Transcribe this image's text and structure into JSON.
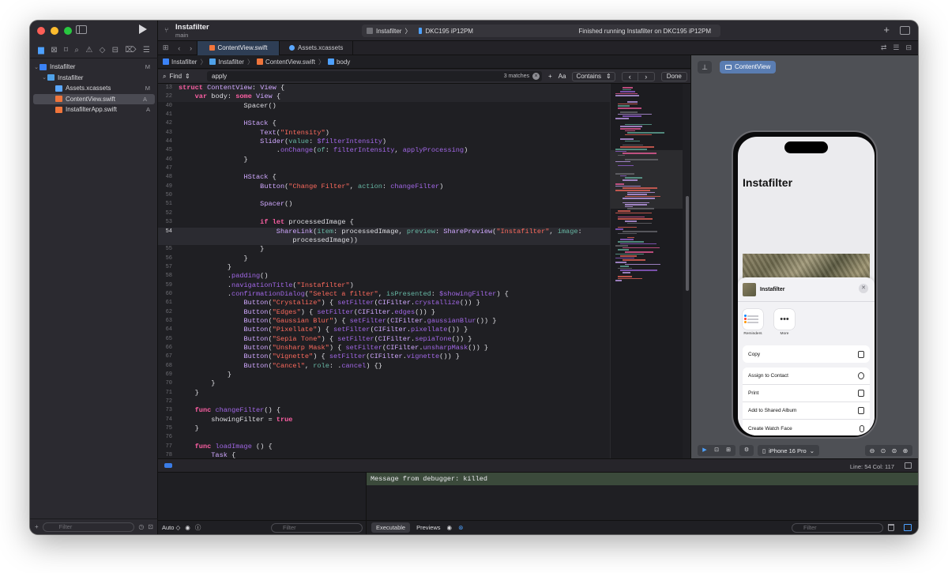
{
  "window": {
    "project_title": "Instafilter",
    "branch": "main",
    "scheme": "Instafilter",
    "device": "DKC195 iP12PM",
    "status": "Finished running Instafilter on DKC195 iP12PM"
  },
  "navigator": {
    "items": [
      {
        "label": "Instafilter",
        "badge": "M",
        "kind": "project",
        "depth": 0
      },
      {
        "label": "Instafilter",
        "badge": "",
        "kind": "folder",
        "depth": 1
      },
      {
        "label": "Assets.xcassets",
        "badge": "M",
        "kind": "assets",
        "depth": 2
      },
      {
        "label": "ContentView.swift",
        "badge": "A",
        "kind": "swift",
        "depth": 2,
        "selected": true
      },
      {
        "label": "InstafilterApp.swift",
        "badge": "A",
        "kind": "swift",
        "depth": 2
      }
    ],
    "filter_placeholder": "Filter"
  },
  "tabs": [
    {
      "label": "ContentView.swift",
      "active": true
    },
    {
      "label": "Assets.xcassets",
      "active": false
    }
  ],
  "jumpbar": {
    "items": [
      "Instafilter",
      "Instafilter",
      "ContentView.swift",
      "body"
    ]
  },
  "find": {
    "mode": "Find",
    "query": "apply",
    "matches": "3 matches",
    "case_label": "Aa",
    "contains_label": "Contains",
    "done_label": "Done"
  },
  "code": {
    "sticky": [
      {
        "n": "13",
        "html": "<span class='kw'>struct</span> <span class='ty'>ContentView</span>: <span class='ty'>View</span> {"
      },
      {
        "n": "22",
        "html": "    <span class='kw'>var</span> body: <span class='kw'>some</span> <span class='ty'>View</span> {"
      }
    ],
    "lines": [
      {
        "n": "40",
        "html": "                Spacer()"
      },
      {
        "n": "41",
        "html": ""
      },
      {
        "n": "42",
        "html": "                <span class='ty'>HStack</span> {"
      },
      {
        "n": "43",
        "html": "                    <span class='ty'>Text</span>(<span class='st'>\"Intensity\"</span>)"
      },
      {
        "n": "44",
        "html": "                    <span class='ty'>Slider</span>(<span class='pr'>value</span>: <span class='fn'>$filterIntensity</span>)"
      },
      {
        "n": "45",
        "html": "                        .<span class='fn'>onChange</span>(<span class='pr'>of</span>: <span class='fn'>filterIntensity</span>, <span class='fn'>applyProcessing</span>)"
      },
      {
        "n": "46",
        "html": "                }"
      },
      {
        "n": "47",
        "html": ""
      },
      {
        "n": "48",
        "html": "                <span class='ty'>HStack</span> {"
      },
      {
        "n": "49",
        "html": "                    <span class='ty'>Button</span>(<span class='st'>\"Change Filter\"</span>, <span class='pr'>action</span>: <span class='fn'>changeFilter</span>)"
      },
      {
        "n": "50",
        "html": ""
      },
      {
        "n": "51",
        "html": "                    <span class='ty'>Spacer</span>()"
      },
      {
        "n": "52",
        "html": ""
      },
      {
        "n": "53",
        "html": "                    <span class='kw'>if</span> <span class='kw'>let</span> processedImage {"
      },
      {
        "n": "54",
        "html": "                        <span class='ty'>ShareLink</span>(<span class='pr'>item</span>: processedImage, <span class='pr'>preview</span>: <span class='ty'>SharePreview</span>(<span class='st'>\"Instafilter\"</span>, <span class='pr'>image</span>:",
        "hl": true
      },
      {
        "n": "",
        "html": "                            processedImage))",
        "hl": true
      },
      {
        "n": "55",
        "html": "                    }"
      },
      {
        "n": "56",
        "html": "                }"
      },
      {
        "n": "57",
        "html": "            }"
      },
      {
        "n": "58",
        "html": "            .<span class='fn'>padding</span>()"
      },
      {
        "n": "59",
        "html": "            .<span class='fn'>navigationTitle</span>(<span class='st'>\"Instafilter\"</span>)"
      },
      {
        "n": "60",
        "html": "            .<span class='fn'>confirmationDialog</span>(<span class='st'>\"Select a filter\"</span>, <span class='pr'>isPresented</span>: <span class='fn'>$showingFilter</span>) {"
      },
      {
        "n": "61",
        "html": "                <span class='ty'>Button</span>(<span class='st'>\"Crystalize\"</span>) { <span class='fn'>setFilter</span>(<span class='ty'>CIFilter</span>.<span class='fn'>crystallize</span>()) }"
      },
      {
        "n": "62",
        "html": "                <span class='ty'>Button</span>(<span class='st'>\"Edges\"</span>) { <span class='fn'>setFilter</span>(<span class='ty'>CIFilter</span>.<span class='fn'>edges</span>()) }"
      },
      {
        "n": "63",
        "html": "                <span class='ty'>Button</span>(<span class='st'>\"Gaussian Blur\"</span>) { <span class='fn'>setFilter</span>(<span class='ty'>CIFilter</span>.<span class='fn'>gaussianBlur</span>()) }"
      },
      {
        "n": "64",
        "html": "                <span class='ty'>Button</span>(<span class='st'>\"Pixellate\"</span>) { <span class='fn'>setFilter</span>(<span class='ty'>CIFilter</span>.<span class='fn'>pixellate</span>()) }"
      },
      {
        "n": "65",
        "html": "                <span class='ty'>Button</span>(<span class='st'>\"Sepia Tone\"</span>) { <span class='fn'>setFilter</span>(<span class='ty'>CIFilter</span>.<span class='fn'>sepiaTone</span>()) }"
      },
      {
        "n": "66",
        "html": "                <span class='ty'>Button</span>(<span class='st'>\"Unsharp Mask\"</span>) { <span class='fn'>setFilter</span>(<span class='ty'>CIFilter</span>.<span class='fn'>unsharpMask</span>()) }"
      },
      {
        "n": "67",
        "html": "                <span class='ty'>Button</span>(<span class='st'>\"Vignette\"</span>) { <span class='fn'>setFilter</span>(<span class='ty'>CIFilter</span>.<span class='fn'>vignette</span>()) }"
      },
      {
        "n": "68",
        "html": "                <span class='ty'>Button</span>(<span class='st'>\"Cancel\"</span>, <span class='pr'>role</span>: .<span class='fn'>cancel</span>) {}"
      },
      {
        "n": "69",
        "html": "            }"
      },
      {
        "n": "70",
        "html": "        }"
      },
      {
        "n": "71",
        "html": "    }"
      },
      {
        "n": "72",
        "html": ""
      },
      {
        "n": "73",
        "html": "    <span class='kw'>func</span> <span class='fn'>changeFilter</span>() {"
      },
      {
        "n": "74",
        "html": "        showingFilter = <span class='kw'>true</span>"
      },
      {
        "n": "75",
        "html": "    }"
      },
      {
        "n": "76",
        "html": ""
      },
      {
        "n": "77",
        "html": "    <span class='kw'>func</span> <span class='fn'>loadImage</span> () {"
      },
      {
        "n": "78",
        "html": "        <span class='ty'>Task</span> {"
      }
    ]
  },
  "canvas": {
    "pill_label": "ContentView",
    "nav_title": "Instafilter",
    "share_title": "Instafilter",
    "apps": [
      {
        "label": "Reminders",
        "icon": "reminders-icon"
      },
      {
        "label": "More",
        "icon": "more-icon"
      }
    ],
    "action_groups": [
      [
        {
          "label": "Copy",
          "icon": "copy-icon"
        }
      ],
      [
        {
          "label": "Assign to Contact",
          "icon": "contact-icon"
        },
        {
          "label": "Print",
          "icon": "print-icon"
        },
        {
          "label": "Add to Shared Album",
          "icon": "shared-album-icon"
        },
        {
          "label": "Create Watch Face",
          "icon": "watch-icon"
        }
      ]
    ],
    "device_label": "iPhone 16 Pro"
  },
  "debug": {
    "position": "Line: 54  Col: 117",
    "console_message": "Message from debugger: killed",
    "auto_label": "Auto ◇",
    "filter_placeholder": "Filter",
    "executable_label": "Executable",
    "previews_label": "Previews"
  },
  "colors": {
    "accent": "#4ea1ff",
    "selection_pill": "#5a7db2",
    "console_highlight": "#3b4a3b"
  }
}
